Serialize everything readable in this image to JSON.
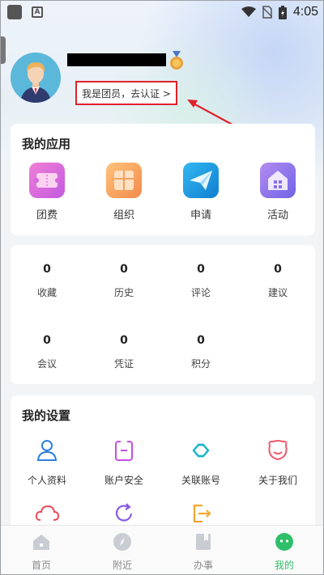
{
  "status_bar": {
    "time": "4:05",
    "icons": [
      "app-icon",
      "a-icon",
      "wifi-icon",
      "no-sim-icon",
      "battery-icon"
    ]
  },
  "profile": {
    "verify_label": "我是团员，去认证 >"
  },
  "apps_card": {
    "title": "我的应用",
    "items": [
      {
        "label": "团费",
        "icon": "ticket-icon",
        "color": "#e86ad8"
      },
      {
        "label": "组织",
        "icon": "org-icon",
        "color": "#f6a45b"
      },
      {
        "label": "申请",
        "icon": "send-icon",
        "color": "#1a9fe0"
      },
      {
        "label": "活动",
        "icon": "home-grid-icon",
        "color": "#8a72ea"
      }
    ]
  },
  "stats_card": {
    "items": [
      {
        "num": "0",
        "label": "收藏"
      },
      {
        "num": "0",
        "label": "历史"
      },
      {
        "num": "0",
        "label": "评论"
      },
      {
        "num": "0",
        "label": "建议"
      },
      {
        "num": "0",
        "label": "会议"
      },
      {
        "num": "0",
        "label": "凭证"
      },
      {
        "num": "0",
        "label": "积分"
      }
    ]
  },
  "settings_card": {
    "title": "我的设置",
    "items": [
      {
        "label": "个人资料",
        "icon": "person-icon"
      },
      {
        "label": "账户安全",
        "icon": "account-security-icon"
      },
      {
        "label": "关联账号",
        "icon": "link-icon"
      },
      {
        "label": "关于我们",
        "icon": "smile-icon"
      },
      {
        "label": "",
        "icon": "cloud-icon"
      },
      {
        "label": "",
        "icon": "refresh-icon"
      },
      {
        "label": "",
        "icon": "logout-icon"
      }
    ]
  },
  "bottom_nav": {
    "items": [
      {
        "label": "首页",
        "icon": "home-icon"
      },
      {
        "label": "附近",
        "icon": "compass-icon"
      },
      {
        "label": "办事",
        "icon": "book-icon"
      },
      {
        "label": "我的",
        "icon": "mine-icon"
      }
    ],
    "active": "我的",
    "active_color": "#2fbf6b"
  }
}
